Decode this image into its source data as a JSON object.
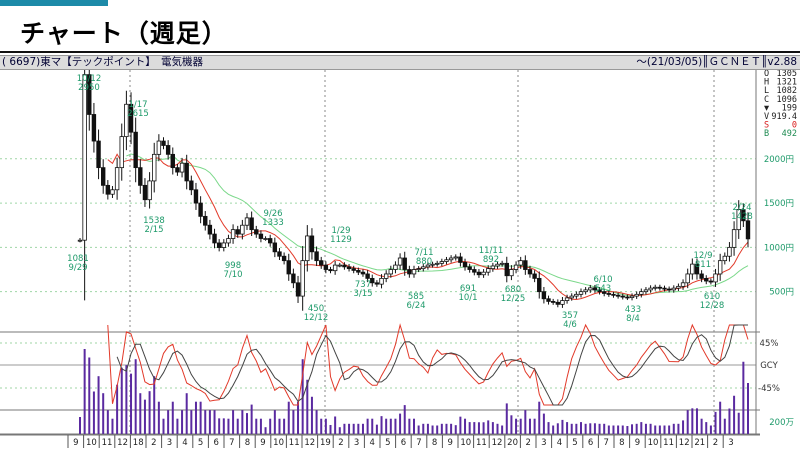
{
  "header": {
    "title": "チャート（週足）"
  },
  "infobar": {
    "code": "( 6697)",
    "market": "東マ",
    "name": "【テックポイント】",
    "sector": "電気機器",
    "date": "～(21/03/05)",
    "source": "ＧＣＮＥＴ",
    "version": "v2.88"
  },
  "ohlc": [
    {
      "k": "O",
      "v": "1305"
    },
    {
      "k": "H",
      "v": "1321"
    },
    {
      "k": "L",
      "v": "1082"
    },
    {
      "k": "C",
      "v": "1096"
    },
    {
      "k": "▼",
      "v": "199"
    },
    {
      "k": "V",
      "v": "919.4"
    },
    {
      "k": "S",
      "v": "0",
      "c": "#d81818"
    },
    {
      "k": "B",
      "v": "492",
      "c": "#1c8a50"
    }
  ],
  "chart_data": {
    "type": "candlestick",
    "price_axis": {
      "ticks": [
        "2000円",
        "1500円",
        "1000円",
        "500円"
      ],
      "values": [
        2000,
        1500,
        1000,
        500
      ],
      "ylim": [
        90,
        2960
      ]
    },
    "oscillator_axis": {
      "ticks": [
        "45%",
        "GCY",
        "-45%"
      ]
    },
    "volume_axis": {
      "ticks": [
        "200万"
      ]
    },
    "x_months": [
      "9",
      "10",
      "11",
      "12",
      "18",
      "2",
      "3",
      "4",
      "5",
      "6",
      "7",
      "8",
      "9",
      "10",
      "11",
      "12",
      "19",
      "2",
      "3",
      "4",
      "5",
      "6",
      "7",
      "8",
      "9",
      "10",
      "11",
      "12",
      "20",
      "2",
      "3",
      "4",
      "5",
      "6",
      "7",
      "8",
      "9",
      "10",
      "11",
      "12",
      "21",
      "2",
      "3"
    ],
    "annotations": [
      {
        "text": [
          "10/12",
          "2950"
        ],
        "x": 89,
        "y": 3
      },
      {
        "text": [
          "1/17",
          "2615"
        ],
        "x": 138,
        "y": 29
      },
      {
        "text": [
          "1081",
          "9/29"
        ],
        "x": 78,
        "y": 183
      },
      {
        "text": [
          "1538",
          "2/15"
        ],
        "x": 154,
        "y": 145
      },
      {
        "text": [
          "9/26",
          "1333"
        ],
        "x": 273,
        "y": 138
      },
      {
        "text": [
          "998",
          "7/10"
        ],
        "x": 233,
        "y": 190
      },
      {
        "text": [
          "1/29",
          "1129"
        ],
        "x": 341,
        "y": 155
      },
      {
        "text": [
          "450",
          "12/12"
        ],
        "x": 316,
        "y": 233
      },
      {
        "text": [
          "737",
          "3/15"
        ],
        "x": 363,
        "y": 209
      },
      {
        "text": [
          "7/11",
          "880"
        ],
        "x": 424,
        "y": 177
      },
      {
        "text": [
          "585",
          "6/24"
        ],
        "x": 416,
        "y": 221
      },
      {
        "text": [
          "11/11",
          "892"
        ],
        "x": 491,
        "y": 175
      },
      {
        "text": [
          "691",
          "10/1"
        ],
        "x": 468,
        "y": 213
      },
      {
        "text": [
          "680",
          "12/25"
        ],
        "x": 513,
        "y": 214
      },
      {
        "text": [
          "357",
          "4/6"
        ],
        "x": 570,
        "y": 240
      },
      {
        "text": [
          "6/10",
          "543"
        ],
        "x": 603,
        "y": 204
      },
      {
        "text": [
          "433",
          "8/4"
        ],
        "x": 633,
        "y": 234
      },
      {
        "text": [
          "12/9",
          "811"
        ],
        "x": 703,
        "y": 180
      },
      {
        "text": [
          "610",
          "12/28"
        ],
        "x": 712,
        "y": 221
      },
      {
        "text": [
          "2/24",
          "1428"
        ],
        "x": 742,
        "y": 132
      }
    ],
    "series": [
      {
        "name": "price",
        "values": [
          1081,
          2950,
          2500,
          2200,
          1900,
          1700,
          1600,
          1650,
          1900,
          2250,
          2615,
          2300,
          1900,
          1700,
          1538,
          1750,
          2050,
          2200,
          2150,
          2050,
          1900,
          1850,
          1950,
          1750,
          1650,
          1500,
          1350,
          1250,
          1150,
          1050,
          998,
          1050,
          1100,
          1200,
          1150,
          1250,
          1333,
          1200,
          1150,
          1100,
          1100,
          1050,
          950,
          900,
          850,
          700,
          600,
          450,
          850,
          1129,
          950,
          850,
          800,
          750,
          737,
          800,
          800,
          780,
          760,
          740,
          720,
          700,
          650,
          600,
          585,
          650,
          700,
          750,
          800,
          880,
          750,
          700,
          750,
          760,
          780,
          800,
          810,
          820,
          840,
          860,
          880,
          892,
          830,
          780,
          750,
          720,
          691,
          720,
          760,
          790,
          810,
          820,
          680,
          750,
          800,
          850,
          750,
          700,
          650,
          500,
          420,
          390,
          380,
          357,
          400,
          430,
          450,
          470,
          500,
          520,
          543,
          520,
          500,
          480,
          470,
          460,
          450,
          440,
          433,
          450,
          470,
          500,
          520,
          540,
          550,
          540,
          530,
          520,
          540,
          560,
          600,
          700,
          811,
          700,
          650,
          620,
          610,
          700,
          850,
          900,
          1000,
          1200,
          1428,
          1300,
          1096
        ]
      }
    ]
  }
}
